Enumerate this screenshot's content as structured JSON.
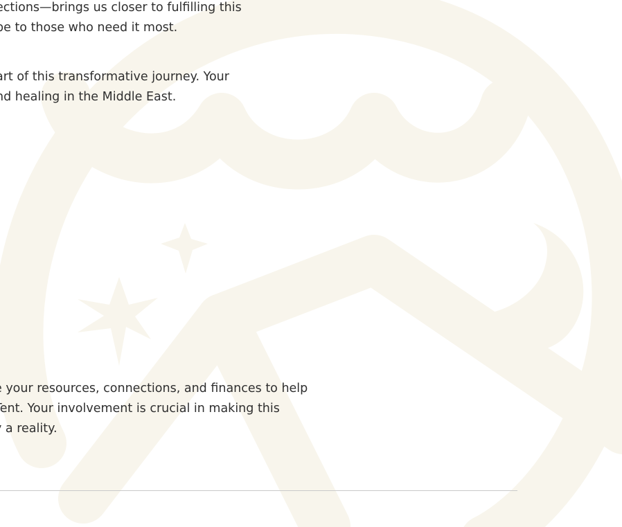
{
  "content": {
    "paragraph_1": [
      "ections—brings us closer to fulfilling this",
      "pe to those who need it most."
    ],
    "paragraph_2": [
      "art of this transformative journey. Your",
      "nd healing in the Middle East."
    ],
    "paragraph_3": [
      "e your resources, connections, and finances to help",
      " Tent. Your involvement is crucial in making this",
      "y a reality."
    ]
  },
  "watermark": {
    "icon": "tent-mountain-moon-stars-logo-icon",
    "color": "#f8f5ec"
  },
  "colors": {
    "text": "#2f2f2f",
    "divider": "#c9c9c9",
    "background": "#ffffff"
  }
}
